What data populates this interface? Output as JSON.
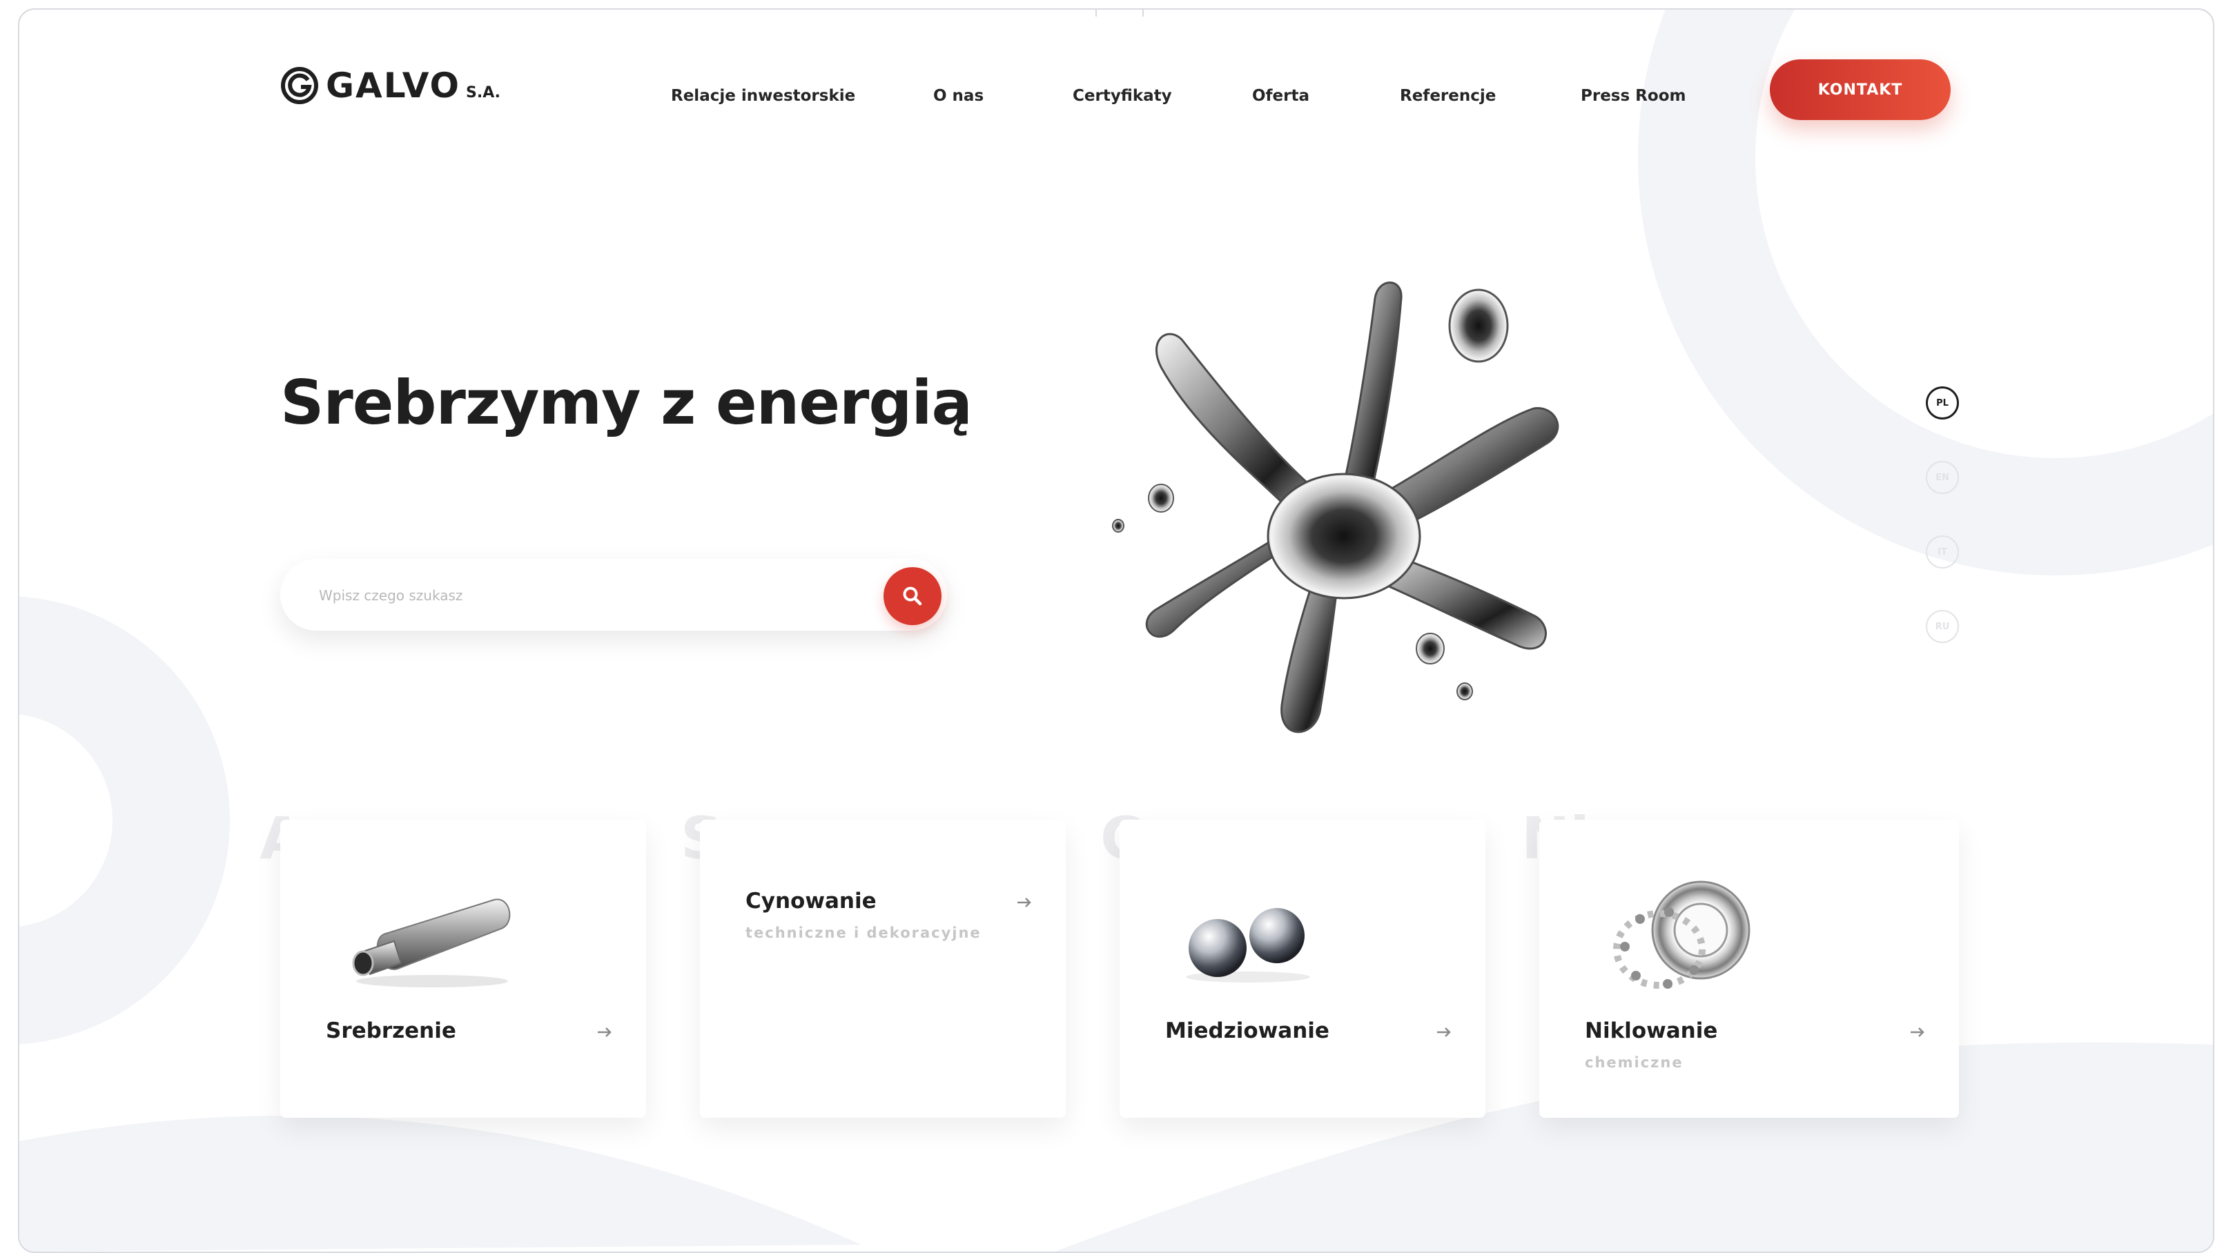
{
  "brand": {
    "name": "GALVO",
    "suffix": "S.A."
  },
  "nav": {
    "items": [
      "Relacje inwestorskie",
      "O nas",
      "Certyfikaty",
      "Oferta",
      "Referencje",
      "Press Room"
    ],
    "cta": "KONTAKT"
  },
  "hero": {
    "title": "Srebrzymy z energią"
  },
  "search": {
    "placeholder": "Wpisz czego szukasz"
  },
  "languages": [
    {
      "code": "PL",
      "active": true
    },
    {
      "code": "EN",
      "active": false
    },
    {
      "code": "IT",
      "active": false
    },
    {
      "code": "RU",
      "active": false
    }
  ],
  "cards": [
    {
      "symbol": "Ag",
      "title": "Srebrzenie",
      "subtitle": "",
      "icon": "exhaust-muffler-icon"
    },
    {
      "symbol": "Sn",
      "title": "Cynowanie",
      "subtitle": "techniczne i dekoracyjne",
      "icon": ""
    },
    {
      "symbol": "Cu",
      "title": "Miedziowanie",
      "subtitle": "",
      "icon": "metal-balls-icon"
    },
    {
      "symbol": "Ni",
      "title": "Niklowanie",
      "subtitle": "chemiczne",
      "icon": "ball-bearing-icon"
    }
  ],
  "colors": {
    "accent": "#d8382d",
    "text": "#1f1f1f",
    "muted": "#c6c6c6",
    "background_shape": "#f3f4f7"
  }
}
